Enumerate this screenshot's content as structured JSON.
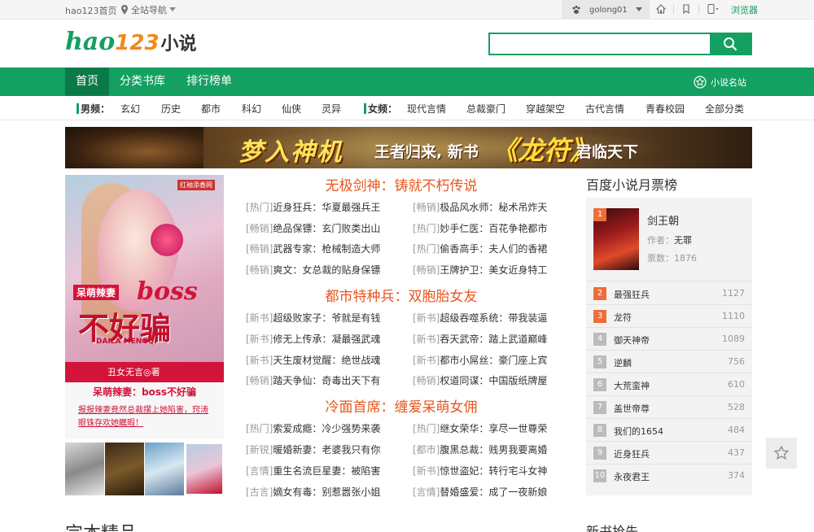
{
  "topbar": {
    "home": "hao123首页",
    "nav": "全站导航",
    "user": "golong01",
    "browser": "浏览器"
  },
  "logo": {
    "h": "hao",
    "n": "123",
    "x": "小说"
  },
  "search": {
    "placeholder": "",
    "button_icon": "search-icon"
  },
  "gnav": {
    "items": [
      "首页",
      "分类书库",
      "排行榜单"
    ],
    "site": "小说名站"
  },
  "cnav": {
    "male_label": "男频：",
    "male": [
      "玄幻",
      "历史",
      "都市",
      "科幻",
      "仙侠",
      "灵异"
    ],
    "female_label": "女频：",
    "female": [
      "现代言情",
      "总裁豪门",
      "穿越架空",
      "古代言情",
      "青春校园",
      "全部分类"
    ]
  },
  "banner": {
    "t1": "梦入神机",
    "t2": "王者归来, 新书",
    "t3": "《龙符》",
    "t4": "君临天下"
  },
  "cover": {
    "brand": "红袖添香网",
    "ct1": "呆萌辣妻",
    "ct2": "boss",
    "ct3": "不好骗",
    "ct4": "DAILA MENGQI",
    "ct5": "丑女无言◎著",
    "title": "呆萌辣妻：boss不好骗",
    "desc": "报报辣妻竟然总裁摆上她陷害，窍涛眼铢存欢她瞩暇！"
  },
  "sections": [
    {
      "title": "无极剑神：铸就不朽传说",
      "rows": [
        [
          "[热门]",
          "近身狂兵：华夏最强兵王",
          "[畅销]",
          "极品风水师：秘术吊炸天"
        ],
        [
          "[畅销]",
          "绝品保镖：玄门败类出山",
          "[热门]",
          "妙手仁医：百花争艳都市"
        ],
        [
          "[畅销]",
          "武器专家：枪械制造大师",
          "[热门]",
          "偷香高手：夫人们的香裙"
        ],
        [
          "[畅销]",
          "爽文：女总裁的贴身保镖",
          "[畅销]",
          "王牌护卫：美女近身特工"
        ]
      ]
    },
    {
      "title": "都市特种兵：双胞胎女友",
      "rows": [
        [
          "[新书]",
          "超级败家子：爷就是有钱",
          "[新书]",
          "超级吞噬系统：带我装逼"
        ],
        [
          "[新书]",
          "修无上传承：凝最强武魂",
          "[新书]",
          "吞天武帝：踏上武道巅峰"
        ],
        [
          "[新书]",
          "天生废材觉醒：绝世战魂",
          "[新书]",
          "都市小屌丝：豪门座上宾"
        ],
        [
          "[畅销]",
          "踏天争仙：奇毒出天下有",
          "[畅销]",
          "权道同谋：中国版纸牌屋"
        ]
      ]
    },
    {
      "title": "冷面首席：缠爱呆萌女佣",
      "rows": [
        [
          "[热门]",
          "索爱成瘾：冷少强势来袭",
          "[热门]",
          "继女荣华：享尽一世尊荣"
        ],
        [
          "[新锐]",
          "暖婚新妻：老婆我只有你",
          "[都市]",
          "腹黑总裁：贱男我要离婚"
        ],
        [
          "[言情]",
          "重生名流巨星妻：被陷害",
          "[新书]",
          "惊世盗妃：转行宅斗女神"
        ],
        [
          "[古言]",
          "嫡女有毒：别惹嚣张小姐",
          "[言情]",
          "替婚盛爱：成了一夜新娘"
        ]
      ]
    }
  ],
  "rank": {
    "heading": "百度小说月票榜",
    "top": {
      "num": "1",
      "name": "剑王朝",
      "author_label": "作者：",
      "author": "无罪",
      "votes_label": "票数：",
      "votes": "1876"
    },
    "items": [
      {
        "num": "2",
        "name": "最强狂兵",
        "votes": "1127"
      },
      {
        "num": "3",
        "name": "龙符",
        "votes": "1110"
      },
      {
        "num": "4",
        "name": "御天神帝",
        "votes": "1089"
      },
      {
        "num": "5",
        "name": "逆麟",
        "votes": "756"
      },
      {
        "num": "6",
        "name": "大荒蛮神",
        "votes": "610"
      },
      {
        "num": "7",
        "name": "盖世帝尊",
        "votes": "528"
      },
      {
        "num": "8",
        "name": "我们的1654",
        "votes": "484"
      },
      {
        "num": "9",
        "name": "近身狂兵",
        "votes": "437"
      },
      {
        "num": "10",
        "name": "永夜君王",
        "votes": "374"
      }
    ]
  },
  "bottom": {
    "left": "完本精品",
    "right": "新书抢先"
  },
  "colors": {
    "brand": "#13a061",
    "accent": "#e8561d",
    "rank_hot": "#ee6d3a"
  }
}
